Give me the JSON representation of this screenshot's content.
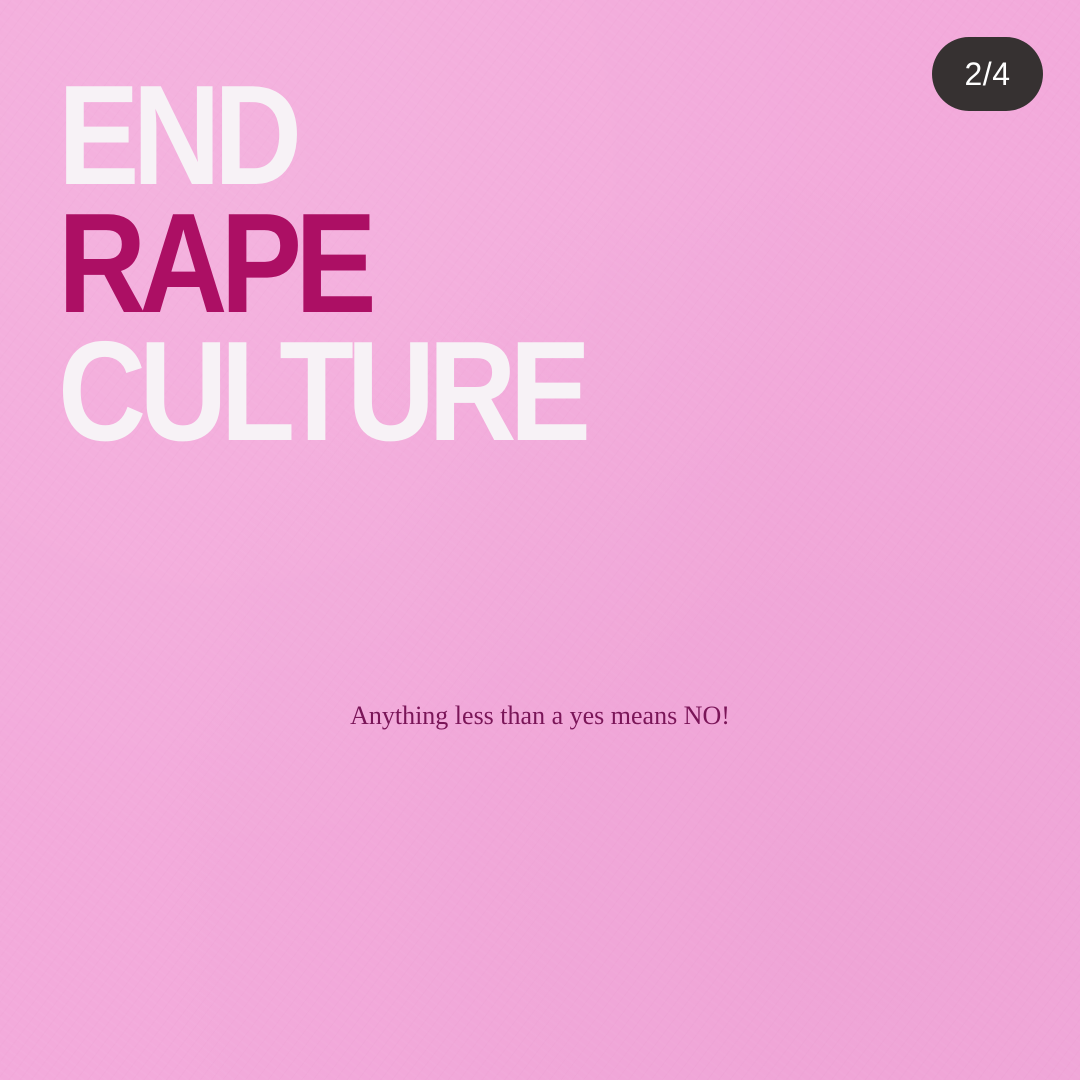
{
  "slide_counter": {
    "label": "2/4"
  },
  "poster": {
    "headline": {
      "line1": "END",
      "line2": "RAPE",
      "line3": "CULTURE"
    },
    "tagline": "Anything less than a yes means NO!"
  },
  "colors": {
    "background": "#f3aadb",
    "headline_light": "#f7f2f6",
    "headline_accent": "#ac0f64",
    "tagline": "#7a1558",
    "badge_background": "#363131",
    "badge_text": "#ffffff"
  }
}
